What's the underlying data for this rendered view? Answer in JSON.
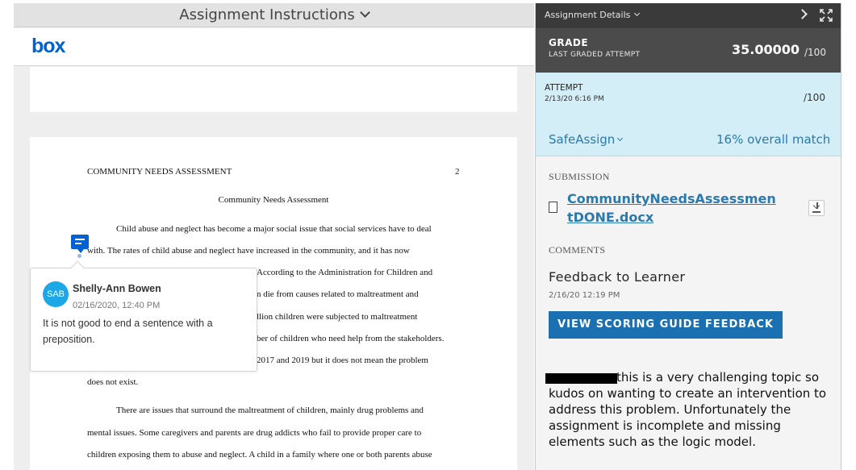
{
  "left_panel": {
    "instructions_title": "Assignment Instructions",
    "box_logo": "box",
    "document": {
      "running_head": "COMMUNITY NEEDS ASSESSMENT",
      "page_number": "2",
      "title": "Community Needs Assessment",
      "lines": [
        "Child abuse and neglect has become a major social issue that social services have to deal",
        "with. The rates of child abuse and neglect have increased in the community, and it has now",
        "According to the Administration for Children and",
        "n die from causes related to maltreatment and",
        "llion children were subjected to maltreatment",
        "ber of children who need help from the stakeholders.",
        "2017 and 2019 but it does not mean the problem",
        "does not exist.",
        "There are issues that surround the maltreatment of children, mainly drug problems and",
        "mental issues. Some caregivers and parents are drug addicts who fail to provide proper care to",
        "children exposing them to abuse and neglect. A child in a family where one or both parents abuse"
      ]
    },
    "comment": {
      "avatar_initials": "SAB",
      "author": "Shelly-Ann Bowen",
      "date": "02/16/2020, 12:40 PM",
      "text": "It is not good to end a sentence with a preposition."
    }
  },
  "right_panel": {
    "header_title": "Assignment Details",
    "grade": {
      "label": "GRADE",
      "sublabel": "LAST GRADED ATTEMPT",
      "score": "35.00000",
      "max": "/100"
    },
    "attempt": {
      "label": "ATTEMPT",
      "date": "2/13/20 6:16 PM",
      "max": "/100",
      "safeassign_label": "SafeAssign",
      "match_text": "16% overall match"
    },
    "submission": {
      "label": "SUBMISSION",
      "file_name": "CommunityNeedsAssessmentDONE.docx"
    },
    "comments": {
      "label": "COMMENTS",
      "feedback_title": "Feedback to Learner",
      "feedback_date": "2/16/20 12:19 PM",
      "button_label": "VIEW SCORING GUIDE FEEDBACK",
      "feedback_text": "this is a very challenging topic so kudos on wanting to create an intervention to address this problem. Unfortunately the assignment is incomplete and missing elements such as the logic model."
    }
  }
}
